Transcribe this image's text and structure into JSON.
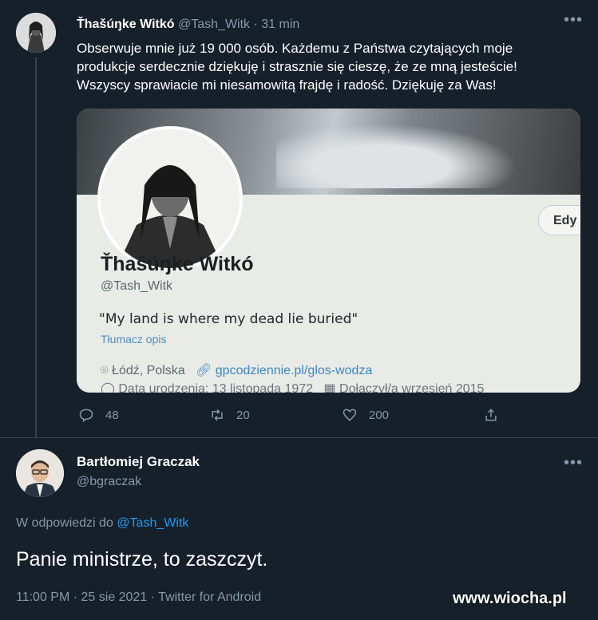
{
  "tweet1": {
    "name": "Ťhašúŋke Witkó",
    "handle": "@Tash_Witk",
    "separator": "·",
    "time": "31 min",
    "text_lines": [
      "Obserwuje mnie już 19 000 osób. Każdemu z Państwa czytających moje",
      "produkcje serdecznie dziękuję i strasznie się cieszę, że ze mną jesteście!",
      "Wszyscy sprawiacie mi niesamowitą frajdę i radość. Dziękuję za Was!"
    ],
    "screenshot": {
      "edit_button": "Edy",
      "profile_name": "Ťhašúŋke Witkó",
      "profile_handle": "@Tash_Witk",
      "bio": "\"My land is where my dead lie buried\"",
      "translate": "Tłumacz opis",
      "location": "Łódź, Polska",
      "website": "gpcodziennie.pl/glos-wodza",
      "birth": "Data urodzenia: 13 listopada 1972",
      "joined": "Dołączył/a wrzesień 2015"
    },
    "actions": {
      "replies": "48",
      "retweets": "20",
      "likes": "200"
    },
    "more_icon": "more-horizontal-icon"
  },
  "tweet2": {
    "name": "Bartłomiej Graczak",
    "handle": "@bgraczak",
    "reply_prefix": "W odpowiedzi do",
    "reply_mention": "@Tash_Witk",
    "text": "Panie ministrze, to zaszczyt.",
    "meta": "11:00 PM · 25 sie 2021 · Twitter for Android"
  },
  "watermark": "www.wiocha.pl",
  "colors": {
    "background": "#15202b",
    "accent": "#1d9bf0",
    "muted": "#8899a6"
  }
}
